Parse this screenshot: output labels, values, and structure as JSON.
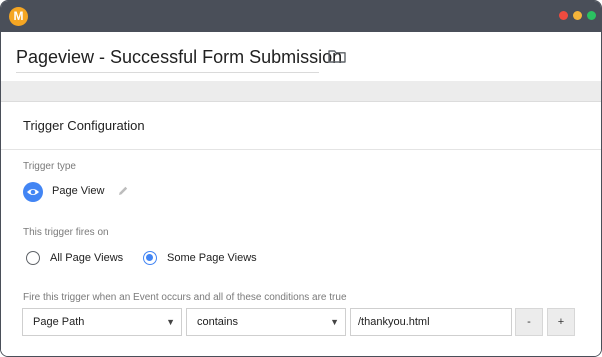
{
  "window": {
    "logo_letter": "M"
  },
  "header": {
    "title": "Pageview - Successful Form Submission"
  },
  "config": {
    "section_title": "Trigger Configuration",
    "trigger_type_label": "Trigger type",
    "trigger_type_value": "Page View",
    "fires_on_label": "This trigger fires on",
    "options": [
      {
        "label": "All Page Views",
        "selected": false
      },
      {
        "label": "Some Page Views",
        "selected": true
      }
    ],
    "condition_label": "Fire this trigger when an Event occurs and all of these conditions are true",
    "condition": {
      "variable": "Page Path",
      "operator": "contains",
      "value": "/thankyou.html"
    },
    "remove_label": "-",
    "add_label": "+"
  },
  "colors": {
    "accent": "#4285f4",
    "titlebar": "#4a4f59",
    "logo": "#f5a623"
  },
  "icons": [
    "folder-icon",
    "eye-icon",
    "pencil-icon",
    "caret-down-icon"
  ]
}
